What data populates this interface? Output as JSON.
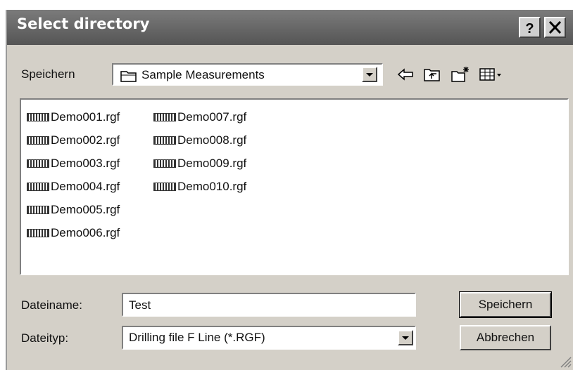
{
  "window": {
    "title": "Select directory"
  },
  "lookin": {
    "label": "Speichern",
    "value": "Sample Measurements"
  },
  "files": {
    "column1": [
      "Demo001.rgf",
      "Demo002.rgf",
      "Demo003.rgf",
      "Demo004.rgf",
      "Demo005.rgf",
      "Demo006.rgf"
    ],
    "column2": [
      "Demo007.rgf",
      "Demo008.rgf",
      "Demo009.rgf",
      "Demo010.rgf"
    ]
  },
  "filename": {
    "label": "Dateiname:",
    "value": "Test"
  },
  "filetype": {
    "label": "Dateityp:",
    "value": "Drilling file F Line (*.RGF)"
  },
  "buttons": {
    "save": "Speichern",
    "cancel": "Abbrechen"
  }
}
